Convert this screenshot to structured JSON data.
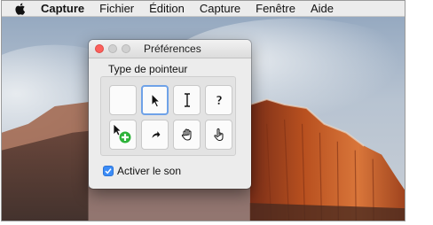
{
  "menubar": {
    "apple_icon": "apple-logo-icon",
    "items": [
      "Capture",
      "Fichier",
      "Édition",
      "Capture",
      "Fenêtre",
      "Aide"
    ]
  },
  "window": {
    "title": "Préférences",
    "section_label": "Type de pointeur",
    "pointer_types": [
      {
        "icon": "blank-pointer-icon",
        "selected": false
      },
      {
        "icon": "arrow-pointer-icon",
        "selected": true
      },
      {
        "icon": "ibeam-pointer-icon",
        "selected": false
      },
      {
        "icon": "question-pointer-icon",
        "selected": false
      },
      {
        "icon": "copy-arrow-pointer-icon",
        "selected": false
      },
      {
        "icon": "alias-arrow-pointer-icon",
        "selected": false
      },
      {
        "icon": "open-hand-pointer-icon",
        "selected": false
      },
      {
        "icon": "pointing-hand-pointer-icon",
        "selected": false
      }
    ],
    "sound_checkbox": {
      "label": "Activer le son",
      "checked": true
    }
  },
  "colors": {
    "accent": "#3b8cf7",
    "close_button": "#fc605c",
    "selection_border": "#6fa2e8"
  }
}
